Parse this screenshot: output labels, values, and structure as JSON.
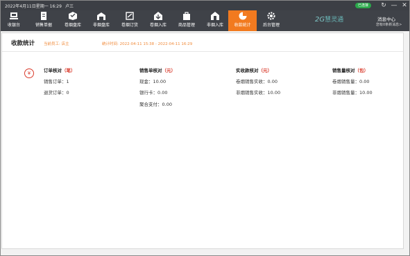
{
  "titlebar": {
    "date": "2022年4月11日星期一 16:29",
    "user": "卢三",
    "status": "已连接"
  },
  "nav": {
    "items": [
      {
        "label": "收银台",
        "icon": "cash-register-icon"
      },
      {
        "label": "销售单据",
        "icon": "receipt-icon"
      },
      {
        "label": "卷烟盘库",
        "icon": "inventory-box-icon"
      },
      {
        "label": "非烟盘库",
        "icon": "warehouse-icon"
      },
      {
        "label": "卷烟订货",
        "icon": "order-icon"
      },
      {
        "label": "卷烟入库",
        "icon": "stock-in-icon"
      },
      {
        "label": "商品管理",
        "icon": "goods-bag-icon"
      },
      {
        "label": "非烟入库",
        "icon": "stock-in-other-icon"
      },
      {
        "label": "收款统计",
        "icon": "pie-chart-icon"
      },
      {
        "label": "后台管理",
        "icon": "gear-icon"
      }
    ],
    "active_index": 8
  },
  "logo": {
    "num": "2G",
    "text": "慧灵通"
  },
  "messages": {
    "title": "消息中心",
    "subtitle": "您有0条新消息>"
  },
  "page": {
    "title": "收款统计",
    "cashier": "当前员工: 店主",
    "period": "统计时间: 2022-04-11 15:38 - 2022-04-11 16:29"
  },
  "stats": {
    "orders": {
      "title": "订单核对",
      "unit": "（笔）",
      "rows": [
        "销售订单：1",
        "退货订单：0"
      ]
    },
    "sales": {
      "title": "销售单核对",
      "unit": "（元）",
      "rows": [
        "现金：10.00",
        "银行卡：0.00",
        "聚合支付：0.00"
      ]
    },
    "received": {
      "title": "实收款核对",
      "unit": "（元）",
      "rows": [
        "卷烟销售实收：0.00",
        "非烟销售实收：10.00"
      ]
    },
    "volume": {
      "title": "销售量核对",
      "unit": "（包）",
      "rows": [
        "卷烟销售量：0.00",
        "非烟销售量：10.00"
      ]
    }
  },
  "colors": {
    "accent": "#f27a1f",
    "nav_bg": "#3f4248",
    "red": "#d93a2b"
  }
}
